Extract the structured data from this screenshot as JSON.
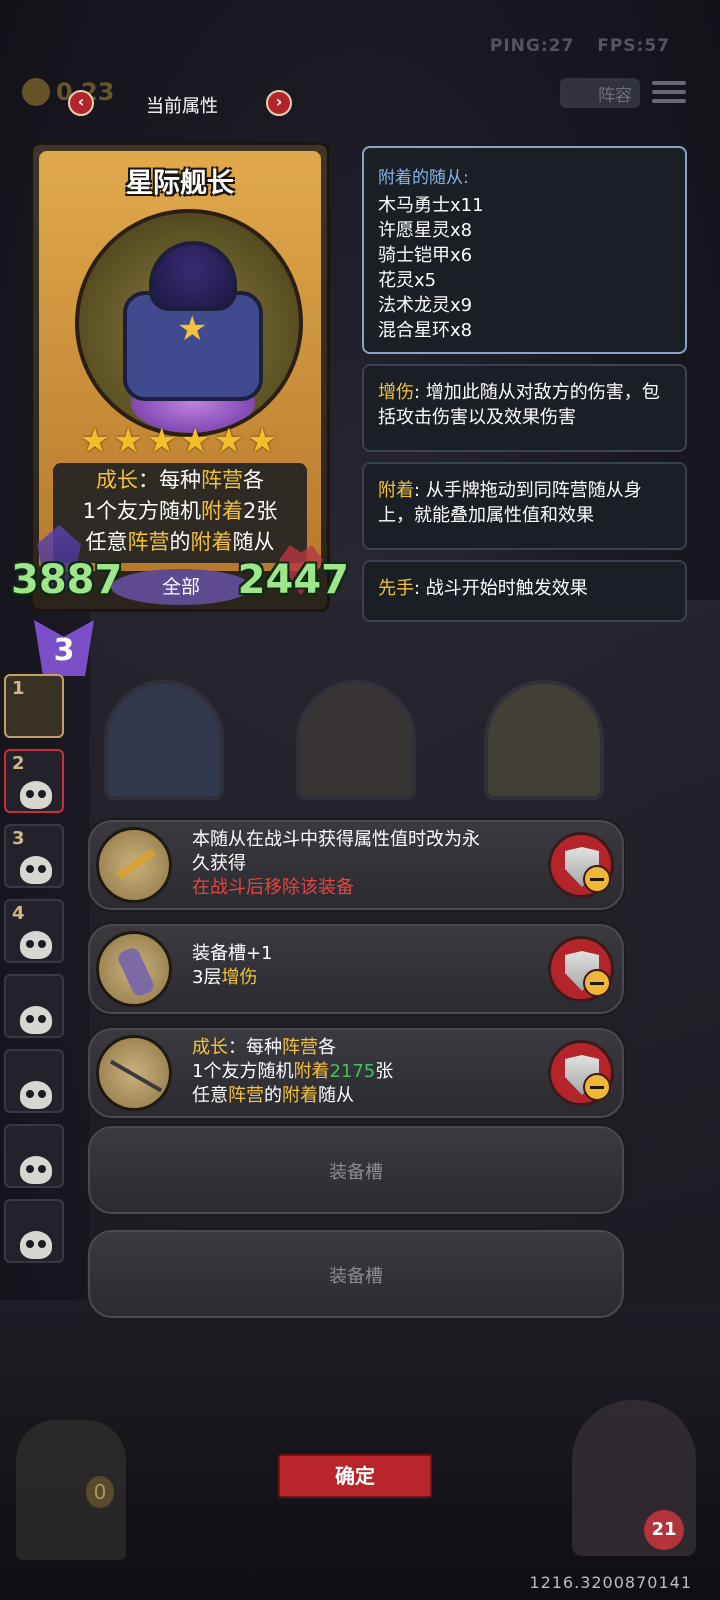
{
  "status": {
    "ping": "PING:27",
    "fps": "FPS:57"
  },
  "top_bar": {
    "coin_value": "0 23",
    "lineup_label": "阵容"
  },
  "header": {
    "title": "当前属性",
    "prev_icon": "chevron-left-icon",
    "next_icon": "chevron-right-icon"
  },
  "card": {
    "name": "星际舰长",
    "stars": "★★★★★★",
    "star_count": 6,
    "desc_line1_a": "成长",
    "desc_line1_b": "：每种",
    "desc_line1_c": "阵营",
    "desc_line1_d": "各",
    "desc_line2_a": "1个友方随机",
    "desc_line2_b": "附着",
    "desc_line2_c": "2张",
    "desc_line3_a": "任意",
    "desc_line3_b": "阵营",
    "desc_line3_c": "的",
    "desc_line3_d": "附着",
    "desc_line3_e": "随从",
    "attack": "3887",
    "health": "2447",
    "tribe": "全部",
    "tier": "3"
  },
  "panels": {
    "attached": {
      "header": "附着的随从:",
      "items": [
        "木马勇士x11",
        "许愿星灵x8",
        "骑士铠甲x6",
        "花灵x5",
        "法术龙灵x9",
        "混合星环x8"
      ]
    },
    "amplify": {
      "key": "增伤",
      "text": ": 增加此随从对敌方的伤害，包括攻击伤害以及效果伤害"
    },
    "attach": {
      "key": "附着",
      "text": ": 从手牌拖动到同阵营随从身上，就能叠加属性值和效果"
    },
    "first_strike": {
      "key": "先手",
      "text": ": 战斗开始时触发效果"
    }
  },
  "roster": [
    {
      "num": "1"
    },
    {
      "num": "2"
    },
    {
      "num": "3"
    },
    {
      "num": "4"
    },
    {
      "num": ""
    },
    {
      "num": ""
    },
    {
      "num": ""
    },
    {
      "num": ""
    }
  ],
  "equipment": [
    {
      "line1": "本随从在战斗中获得属性值时改为永",
      "line2": "久获得",
      "line3": "在战斗后移除该装备",
      "icon": "blade-icon"
    },
    {
      "line1": "装备槽+1",
      "line2_a": "3层",
      "line2_b": "增伤",
      "icon": "gauntlet-icon"
    },
    {
      "line1_a": "成长",
      "line1_b": "：每种",
      "line1_c": "阵营",
      "line1_d": "各",
      "line2_a": "1个友方随机",
      "line2_b": "附着",
      "line2_c": "2175",
      "line2_d": "张",
      "line3_a": "任意",
      "line3_b": "阵营",
      "line3_c": "的",
      "line3_d": "附着",
      "line3_e": "随从",
      "icon": "spear-icon"
    }
  ],
  "empty_slot_label": "装备槽",
  "confirm_label": "确定",
  "chest_count": "0",
  "hero_hp": "21",
  "coords": "1216.3200870141",
  "colors": {
    "highlight_yellow": "#f2c33a",
    "warning_red": "#e5453e",
    "number_green": "#43c35a",
    "stat_green": "#9fe58c",
    "button_red": "#b8262b"
  }
}
